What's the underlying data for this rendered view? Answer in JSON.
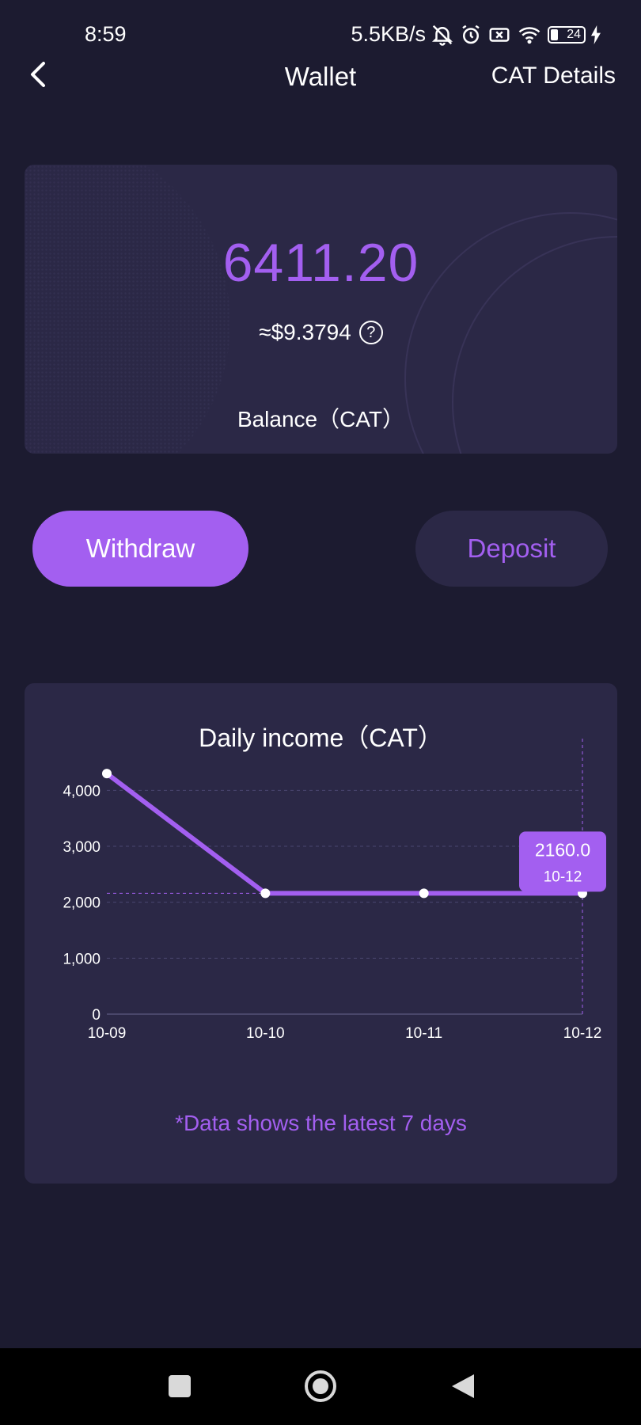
{
  "status_bar": {
    "time": "8:59",
    "network_speed": "5.5KB/s",
    "battery_level": "24",
    "icons": [
      "bell-muted-icon",
      "alarm-icon",
      "sim-blocked-icon",
      "wifi-icon",
      "battery-icon",
      "charging-icon"
    ]
  },
  "header": {
    "back_icon": "chevron-left-icon",
    "title": "Wallet",
    "details_label": "CAT Details"
  },
  "balance": {
    "amount": "6411.20",
    "usd_value": "≈$9.3794",
    "help_icon": "question-circle-icon",
    "help_symbol": "?",
    "label": "Balance（CAT）"
  },
  "actions": {
    "withdraw_label": "Withdraw",
    "deposit_label": "Deposit"
  },
  "chart_card": {
    "note": "*Data shows the latest 7 days"
  },
  "chart_data": {
    "type": "line",
    "title": "Daily income（CAT）",
    "x": [
      "10-09",
      "10-10",
      "10-11",
      "10-12"
    ],
    "series": [
      {
        "values": [
          4300,
          2160,
          2160,
          2160
        ]
      }
    ],
    "ylim": [
      0,
      4500
    ],
    "yticks": [
      0,
      1000,
      2000,
      3000,
      4000
    ],
    "ytick_labels": [
      "0",
      "1,000",
      "2,000",
      "3,000",
      "4,000"
    ],
    "grid": true,
    "tooltip": {
      "value": "2160.0",
      "label": "10-12"
    },
    "colors": {
      "line": "#a35ff0",
      "grid": "#4a4670",
      "axis_text": "#ffffff"
    }
  },
  "nav_bar": {
    "icons": [
      "square-icon",
      "home-circle-icon",
      "back-triangle-icon"
    ]
  },
  "colors": {
    "background": "#1c1b30",
    "card": "#2b2846",
    "accent": "#a35ff0"
  }
}
